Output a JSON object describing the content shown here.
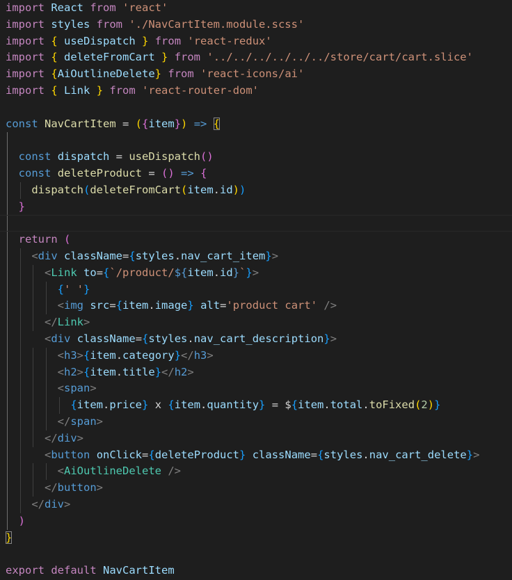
{
  "editor": {
    "language": "javascript-react",
    "theme_background": "#1e1e1e",
    "lines": [
      [
        [
          "import",
          "kw-ctl"
        ],
        [
          " React ",
          "ident"
        ],
        [
          "from",
          "kw-ctl"
        ],
        [
          " ",
          "plain"
        ],
        [
          "'react'",
          "str"
        ]
      ],
      [
        [
          "import",
          "kw-ctl"
        ],
        [
          " styles ",
          "ident"
        ],
        [
          "from",
          "kw-ctl"
        ],
        [
          " ",
          "plain"
        ],
        [
          "'./NavCartItem.module.scss'",
          "str"
        ]
      ],
      [
        [
          "import",
          "kw-ctl"
        ],
        [
          " ",
          "plain"
        ],
        [
          "{",
          "br1"
        ],
        [
          " useDispatch ",
          "ident"
        ],
        [
          "}",
          "br1"
        ],
        [
          " ",
          "plain"
        ],
        [
          "from",
          "kw-ctl"
        ],
        [
          " ",
          "plain"
        ],
        [
          "'react-redux'",
          "str"
        ]
      ],
      [
        [
          "import",
          "kw-ctl"
        ],
        [
          " ",
          "plain"
        ],
        [
          "{",
          "br1"
        ],
        [
          " deleteFromCart ",
          "ident"
        ],
        [
          "}",
          "br1"
        ],
        [
          " ",
          "plain"
        ],
        [
          "from",
          "kw-ctl"
        ],
        [
          " ",
          "plain"
        ],
        [
          "'../../../../../../store/cart/cart.slice'",
          "str"
        ]
      ],
      [
        [
          "import",
          "kw-ctl"
        ],
        [
          " ",
          "plain"
        ],
        [
          "{",
          "br1"
        ],
        [
          "AiOutlineDelete",
          "ident"
        ],
        [
          "}",
          "br1"
        ],
        [
          " ",
          "plain"
        ],
        [
          "from",
          "kw-ctl"
        ],
        [
          " ",
          "plain"
        ],
        [
          "'react-icons/ai'",
          "str"
        ]
      ],
      [
        [
          "import",
          "kw-ctl"
        ],
        [
          " ",
          "plain"
        ],
        [
          "{",
          "br1"
        ],
        [
          " Link ",
          "ident"
        ],
        [
          "}",
          "br1"
        ],
        [
          " ",
          "plain"
        ],
        [
          "from",
          "kw-ctl"
        ],
        [
          " ",
          "plain"
        ],
        [
          "'react-router-dom'",
          "str"
        ]
      ],
      [],
      [
        [
          "const",
          "kw-decl"
        ],
        [
          " ",
          "plain"
        ],
        [
          "NavCartItem",
          "func"
        ],
        [
          " = ",
          "plain"
        ],
        [
          "(",
          "br1"
        ],
        [
          "{",
          "br2"
        ],
        [
          "item",
          "ident"
        ],
        [
          "}",
          "br2"
        ],
        [
          ")",
          "br1"
        ],
        [
          " ",
          "plain"
        ],
        [
          "=>",
          "kw-decl"
        ],
        [
          " ",
          "plain"
        ],
        [
          "{",
          "br1"
        ]
      ],
      [],
      [
        [
          "  ",
          "plain"
        ],
        [
          "const",
          "kw-decl"
        ],
        [
          " ",
          "plain"
        ],
        [
          "dispatch",
          "ident"
        ],
        [
          " = ",
          "plain"
        ],
        [
          "useDispatch",
          "func"
        ],
        [
          "(",
          "br2"
        ],
        [
          ")",
          "br2"
        ]
      ],
      [
        [
          "  ",
          "plain"
        ],
        [
          "const",
          "kw-decl"
        ],
        [
          " ",
          "plain"
        ],
        [
          "deleteProduct",
          "func"
        ],
        [
          " = ",
          "plain"
        ],
        [
          "(",
          "br2"
        ],
        [
          ")",
          "br2"
        ],
        [
          " ",
          "plain"
        ],
        [
          "=>",
          "kw-decl"
        ],
        [
          " ",
          "plain"
        ],
        [
          "{",
          "br2"
        ]
      ],
      [
        [
          "    ",
          "plain"
        ],
        [
          "dispatch",
          "func"
        ],
        [
          "(",
          "br3"
        ],
        [
          "deleteFromCart",
          "func"
        ],
        [
          "(",
          "br1"
        ],
        [
          "item",
          "ident"
        ],
        [
          ".",
          "plain"
        ],
        [
          "id",
          "ident"
        ],
        [
          ")",
          "br1"
        ],
        [
          ")",
          "br3"
        ]
      ],
      [
        [
          "  ",
          "plain"
        ],
        [
          "}",
          "br2"
        ]
      ],
      [],
      [
        [
          "  ",
          "plain"
        ],
        [
          "return",
          "kw-ctl"
        ],
        [
          " ",
          "plain"
        ],
        [
          "(",
          "br2"
        ]
      ],
      [
        [
          "    ",
          "plain"
        ],
        [
          "<",
          "punct"
        ],
        [
          "div",
          "tag"
        ],
        [
          " ",
          "plain"
        ],
        [
          "className",
          "attr"
        ],
        [
          "=",
          "plain"
        ],
        [
          "{",
          "br3"
        ],
        [
          "styles",
          "ident"
        ],
        [
          ".",
          "plain"
        ],
        [
          "nav_cart_item",
          "ident"
        ],
        [
          "}",
          "br3"
        ],
        [
          ">",
          "punct"
        ]
      ],
      [
        [
          "      ",
          "plain"
        ],
        [
          "<",
          "punct"
        ],
        [
          "Link",
          "comp"
        ],
        [
          " ",
          "plain"
        ],
        [
          "to",
          "attr"
        ],
        [
          "=",
          "plain"
        ],
        [
          "{",
          "br3"
        ],
        [
          "`/product/",
          "tpl"
        ],
        [
          "${",
          "dollar"
        ],
        [
          "item",
          "ident"
        ],
        [
          ".",
          "plain"
        ],
        [
          "id",
          "ident"
        ],
        [
          "}",
          "dollar"
        ],
        [
          "`",
          "tpl"
        ],
        [
          "}",
          "br3"
        ],
        [
          ">",
          "punct"
        ]
      ],
      [
        [
          "        ",
          "plain"
        ],
        [
          "{",
          "br3"
        ],
        [
          "' '",
          "str"
        ],
        [
          "}",
          "br3"
        ]
      ],
      [
        [
          "        ",
          "plain"
        ],
        [
          "<",
          "punct"
        ],
        [
          "img",
          "tag"
        ],
        [
          " ",
          "plain"
        ],
        [
          "src",
          "attr"
        ],
        [
          "=",
          "plain"
        ],
        [
          "{",
          "br3"
        ],
        [
          "item",
          "ident"
        ],
        [
          ".",
          "plain"
        ],
        [
          "image",
          "ident"
        ],
        [
          "}",
          "br3"
        ],
        [
          " ",
          "plain"
        ],
        [
          "alt",
          "attr"
        ],
        [
          "=",
          "plain"
        ],
        [
          "'product cart'",
          "str"
        ],
        [
          " ",
          "plain"
        ],
        [
          "/>",
          "punct"
        ]
      ],
      [
        [
          "      ",
          "plain"
        ],
        [
          "</",
          "punct"
        ],
        [
          "Link",
          "comp"
        ],
        [
          ">",
          "punct"
        ]
      ],
      [
        [
          "      ",
          "plain"
        ],
        [
          "<",
          "punct"
        ],
        [
          "div",
          "tag"
        ],
        [
          " ",
          "plain"
        ],
        [
          "className",
          "attr"
        ],
        [
          "=",
          "plain"
        ],
        [
          "{",
          "br3"
        ],
        [
          "styles",
          "ident"
        ],
        [
          ".",
          "plain"
        ],
        [
          "nav_cart_description",
          "ident"
        ],
        [
          "}",
          "br3"
        ],
        [
          ">",
          "punct"
        ]
      ],
      [
        [
          "        ",
          "plain"
        ],
        [
          "<",
          "punct"
        ],
        [
          "h3",
          "tag"
        ],
        [
          ">",
          "punct"
        ],
        [
          "{",
          "br3"
        ],
        [
          "item",
          "ident"
        ],
        [
          ".",
          "plain"
        ],
        [
          "category",
          "ident"
        ],
        [
          "}",
          "br3"
        ],
        [
          "</",
          "punct"
        ],
        [
          "h3",
          "tag"
        ],
        [
          ">",
          "punct"
        ]
      ],
      [
        [
          "        ",
          "plain"
        ],
        [
          "<",
          "punct"
        ],
        [
          "h2",
          "tag"
        ],
        [
          ">",
          "punct"
        ],
        [
          "{",
          "br3"
        ],
        [
          "item",
          "ident"
        ],
        [
          ".",
          "plain"
        ],
        [
          "title",
          "ident"
        ],
        [
          "}",
          "br3"
        ],
        [
          "</",
          "punct"
        ],
        [
          "h2",
          "tag"
        ],
        [
          ">",
          "punct"
        ]
      ],
      [
        [
          "        ",
          "plain"
        ],
        [
          "<",
          "punct"
        ],
        [
          "span",
          "tag"
        ],
        [
          ">",
          "punct"
        ]
      ],
      [
        [
          "          ",
          "plain"
        ],
        [
          "{",
          "br3"
        ],
        [
          "item",
          "ident"
        ],
        [
          ".",
          "plain"
        ],
        [
          "price",
          "ident"
        ],
        [
          "}",
          "br3"
        ],
        [
          " x ",
          "plain"
        ],
        [
          "{",
          "br3"
        ],
        [
          "item",
          "ident"
        ],
        [
          ".",
          "plain"
        ],
        [
          "quantity",
          "ident"
        ],
        [
          "}",
          "br3"
        ],
        [
          " = $",
          "plain"
        ],
        [
          "{",
          "br3"
        ],
        [
          "item",
          "ident"
        ],
        [
          ".",
          "plain"
        ],
        [
          "total",
          "ident"
        ],
        [
          ".",
          "plain"
        ],
        [
          "toFixed",
          "func"
        ],
        [
          "(",
          "br1"
        ],
        [
          "2",
          "num"
        ],
        [
          ")",
          "br1"
        ],
        [
          "}",
          "br3"
        ]
      ],
      [
        [
          "        ",
          "plain"
        ],
        [
          "</",
          "punct"
        ],
        [
          "span",
          "tag"
        ],
        [
          ">",
          "punct"
        ]
      ],
      [
        [
          "      ",
          "plain"
        ],
        [
          "</",
          "punct"
        ],
        [
          "div",
          "tag"
        ],
        [
          ">",
          "punct"
        ]
      ],
      [
        [
          "      ",
          "plain"
        ],
        [
          "<",
          "punct"
        ],
        [
          "button",
          "tag"
        ],
        [
          " ",
          "plain"
        ],
        [
          "onClick",
          "attr"
        ],
        [
          "=",
          "plain"
        ],
        [
          "{",
          "br3"
        ],
        [
          "deleteProduct",
          "ident"
        ],
        [
          "}",
          "br3"
        ],
        [
          " ",
          "plain"
        ],
        [
          "className",
          "attr"
        ],
        [
          "=",
          "plain"
        ],
        [
          "{",
          "br3"
        ],
        [
          "styles",
          "ident"
        ],
        [
          ".",
          "plain"
        ],
        [
          "nav_cart_delete",
          "ident"
        ],
        [
          "}",
          "br3"
        ],
        [
          ">",
          "punct"
        ]
      ],
      [
        [
          "        ",
          "plain"
        ],
        [
          "<",
          "punct"
        ],
        [
          "AiOutlineDelete",
          "comp"
        ],
        [
          " ",
          "plain"
        ],
        [
          "/>",
          "punct"
        ]
      ],
      [
        [
          "      ",
          "plain"
        ],
        [
          "</",
          "punct"
        ],
        [
          "button",
          "tag"
        ],
        [
          ">",
          "punct"
        ]
      ],
      [
        [
          "    ",
          "plain"
        ],
        [
          "</",
          "punct"
        ],
        [
          "div",
          "tag"
        ],
        [
          ">",
          "punct"
        ]
      ],
      [
        [
          "  ",
          "plain"
        ],
        [
          ")",
          "br2"
        ]
      ],
      [
        [
          "}",
          "br1"
        ]
      ],
      [],
      [
        [
          "export",
          "kw-ctl"
        ],
        [
          " ",
          "plain"
        ],
        [
          "default",
          "kw-ctl"
        ],
        [
          " NavCartItem",
          "ident"
        ]
      ]
    ]
  }
}
